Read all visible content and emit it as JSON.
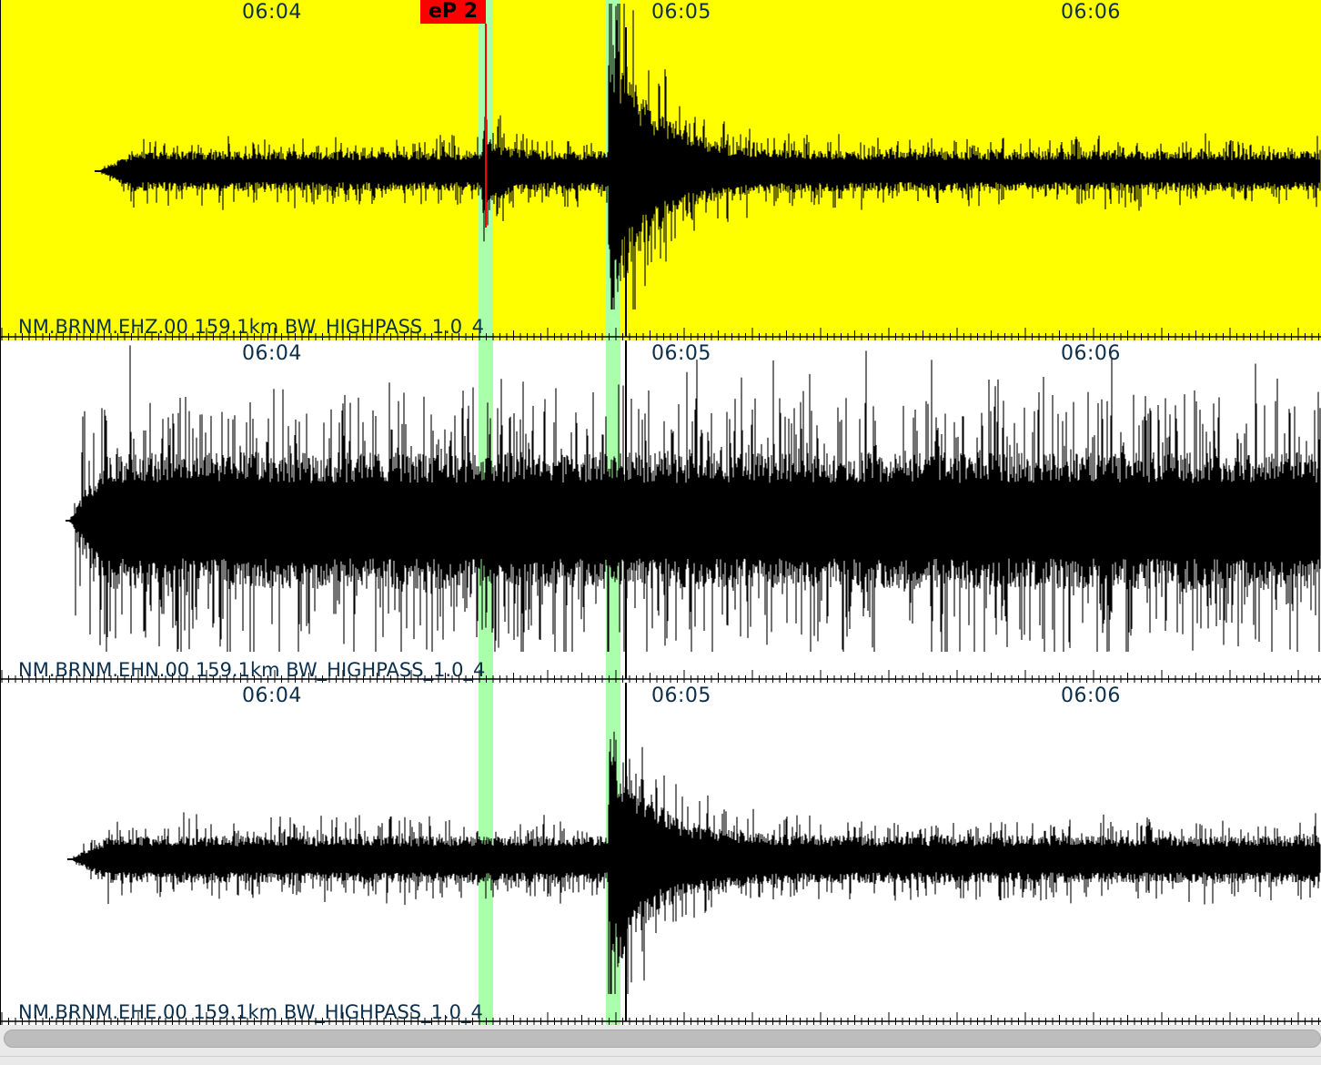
{
  "colors": {
    "selected_bg": "#ffff00",
    "bg": "#ffffff",
    "trace": "#000000",
    "window": "#aaffaa",
    "pick": "#ff0000"
  },
  "time_labels": [
    "06:04",
    "06:05",
    "06:06"
  ],
  "pick": {
    "label": "eP 2",
    "color": "#ff0000"
  },
  "channels": [
    {
      "label": "NM.BRNM.EHZ.00 159.1km BW_HIGHPASS_1.0_4",
      "component": "EHZ",
      "selected": true,
      "amplitude": 0.55
    },
    {
      "label": "NM.BRNM.EHN.00 159.1km BW_HIGHPASS_1.0_4",
      "component": "EHN",
      "selected": false,
      "amplitude": 1.0
    },
    {
      "label": "NM.BRNM.EHE.00 159.1km BW_HIGHPASS_1.0_4",
      "component": "EHE",
      "selected": false,
      "amplitude": 0.6
    }
  ],
  "scrollbar": {
    "icon": "horizontal-scrollbar"
  }
}
